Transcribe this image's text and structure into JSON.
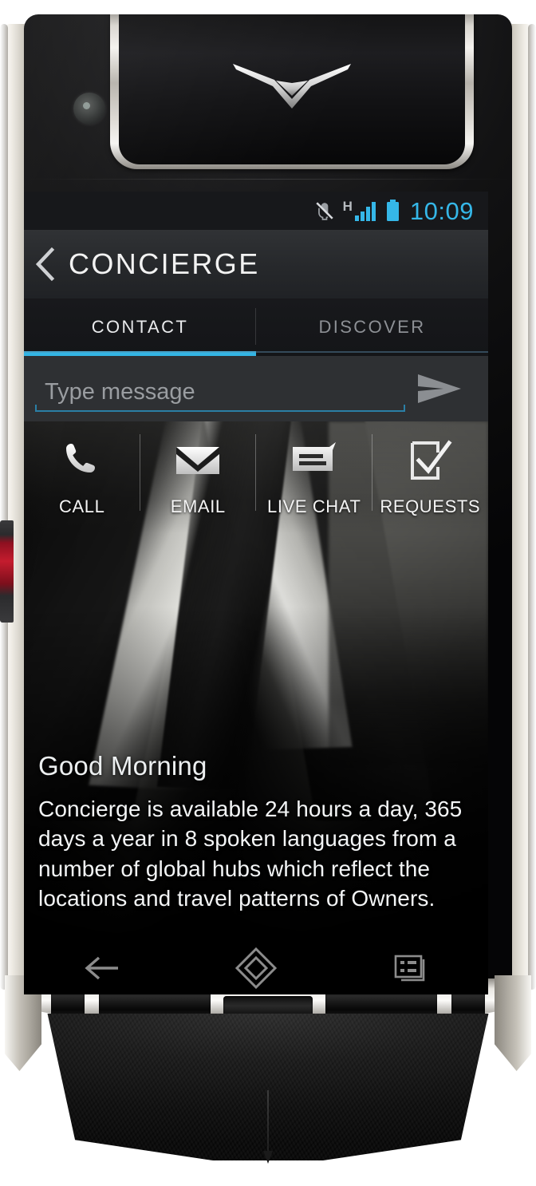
{
  "device": {
    "brand_logo": "vertu-v-logo",
    "camera": "front-camera"
  },
  "status_bar": {
    "time": "10:09",
    "icons": [
      {
        "name": "mute-vibrate-icon",
        "label": "silent"
      },
      {
        "name": "signal-h-icon",
        "label": "H"
      },
      {
        "name": "battery-icon",
        "label": "battery"
      }
    ],
    "network_type": "H",
    "accent_color": "#33b5e5"
  },
  "action_bar": {
    "back_label": "back",
    "title": "CONCIERGE"
  },
  "tabs": [
    {
      "label": "CONTACT",
      "active": true
    },
    {
      "label": "DISCOVER",
      "active": false
    }
  ],
  "compose": {
    "placeholder": "Type message",
    "value": "",
    "send_label": "send"
  },
  "quick_actions": [
    {
      "label": "CALL",
      "icon": "phone-icon"
    },
    {
      "label": "EMAIL",
      "icon": "envelope-icon"
    },
    {
      "label": "LIVE CHAT",
      "icon": "chat-bubble-icon"
    },
    {
      "label": "REQUESTS",
      "icon": "checklist-icon"
    }
  ],
  "content": {
    "greeting": "Good Morning",
    "description": "Concierge is available 24 hours a day, 365 days a year in 8 spoken languages from a number of global hubs which reflect the locations and travel patterns of  Owners."
  },
  "nav_bar": [
    {
      "name": "back",
      "icon": "arrow-left-icon"
    },
    {
      "name": "home",
      "icon": "diamond-home-icon"
    },
    {
      "name": "recents",
      "icon": "recent-apps-icon"
    }
  ]
}
